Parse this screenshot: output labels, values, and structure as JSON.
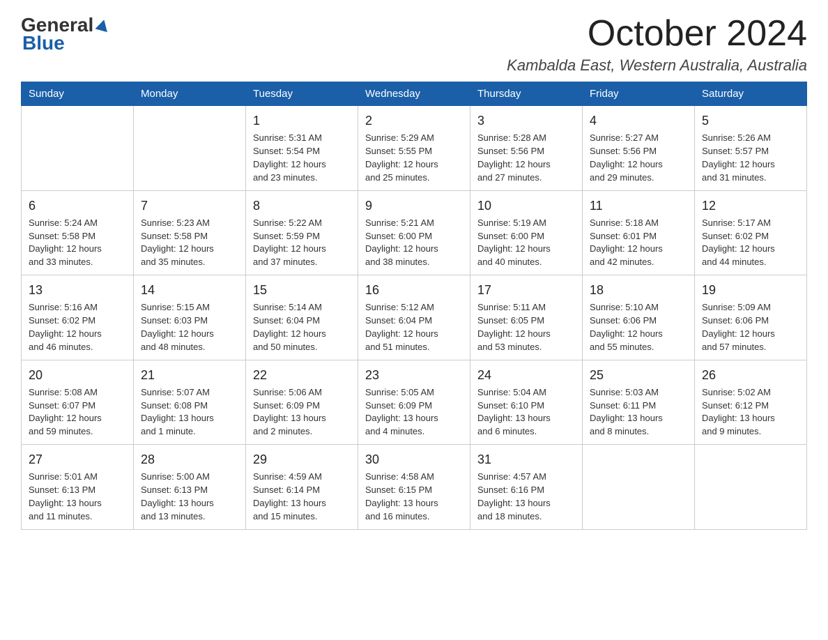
{
  "header": {
    "logo_text1": "General",
    "logo_text2": "Blue",
    "month_title": "October 2024",
    "location": "Kambalda East, Western Australia, Australia"
  },
  "days_of_week": [
    "Sunday",
    "Monday",
    "Tuesday",
    "Wednesday",
    "Thursday",
    "Friday",
    "Saturday"
  ],
  "weeks": [
    [
      {
        "day": "",
        "info": ""
      },
      {
        "day": "",
        "info": ""
      },
      {
        "day": "1",
        "info": "Sunrise: 5:31 AM\nSunset: 5:54 PM\nDaylight: 12 hours\nand 23 minutes."
      },
      {
        "day": "2",
        "info": "Sunrise: 5:29 AM\nSunset: 5:55 PM\nDaylight: 12 hours\nand 25 minutes."
      },
      {
        "day": "3",
        "info": "Sunrise: 5:28 AM\nSunset: 5:56 PM\nDaylight: 12 hours\nand 27 minutes."
      },
      {
        "day": "4",
        "info": "Sunrise: 5:27 AM\nSunset: 5:56 PM\nDaylight: 12 hours\nand 29 minutes."
      },
      {
        "day": "5",
        "info": "Sunrise: 5:26 AM\nSunset: 5:57 PM\nDaylight: 12 hours\nand 31 minutes."
      }
    ],
    [
      {
        "day": "6",
        "info": "Sunrise: 5:24 AM\nSunset: 5:58 PM\nDaylight: 12 hours\nand 33 minutes."
      },
      {
        "day": "7",
        "info": "Sunrise: 5:23 AM\nSunset: 5:58 PM\nDaylight: 12 hours\nand 35 minutes."
      },
      {
        "day": "8",
        "info": "Sunrise: 5:22 AM\nSunset: 5:59 PM\nDaylight: 12 hours\nand 37 minutes."
      },
      {
        "day": "9",
        "info": "Sunrise: 5:21 AM\nSunset: 6:00 PM\nDaylight: 12 hours\nand 38 minutes."
      },
      {
        "day": "10",
        "info": "Sunrise: 5:19 AM\nSunset: 6:00 PM\nDaylight: 12 hours\nand 40 minutes."
      },
      {
        "day": "11",
        "info": "Sunrise: 5:18 AM\nSunset: 6:01 PM\nDaylight: 12 hours\nand 42 minutes."
      },
      {
        "day": "12",
        "info": "Sunrise: 5:17 AM\nSunset: 6:02 PM\nDaylight: 12 hours\nand 44 minutes."
      }
    ],
    [
      {
        "day": "13",
        "info": "Sunrise: 5:16 AM\nSunset: 6:02 PM\nDaylight: 12 hours\nand 46 minutes."
      },
      {
        "day": "14",
        "info": "Sunrise: 5:15 AM\nSunset: 6:03 PM\nDaylight: 12 hours\nand 48 minutes."
      },
      {
        "day": "15",
        "info": "Sunrise: 5:14 AM\nSunset: 6:04 PM\nDaylight: 12 hours\nand 50 minutes."
      },
      {
        "day": "16",
        "info": "Sunrise: 5:12 AM\nSunset: 6:04 PM\nDaylight: 12 hours\nand 51 minutes."
      },
      {
        "day": "17",
        "info": "Sunrise: 5:11 AM\nSunset: 6:05 PM\nDaylight: 12 hours\nand 53 minutes."
      },
      {
        "day": "18",
        "info": "Sunrise: 5:10 AM\nSunset: 6:06 PM\nDaylight: 12 hours\nand 55 minutes."
      },
      {
        "day": "19",
        "info": "Sunrise: 5:09 AM\nSunset: 6:06 PM\nDaylight: 12 hours\nand 57 minutes."
      }
    ],
    [
      {
        "day": "20",
        "info": "Sunrise: 5:08 AM\nSunset: 6:07 PM\nDaylight: 12 hours\nand 59 minutes."
      },
      {
        "day": "21",
        "info": "Sunrise: 5:07 AM\nSunset: 6:08 PM\nDaylight: 13 hours\nand 1 minute."
      },
      {
        "day": "22",
        "info": "Sunrise: 5:06 AM\nSunset: 6:09 PM\nDaylight: 13 hours\nand 2 minutes."
      },
      {
        "day": "23",
        "info": "Sunrise: 5:05 AM\nSunset: 6:09 PM\nDaylight: 13 hours\nand 4 minutes."
      },
      {
        "day": "24",
        "info": "Sunrise: 5:04 AM\nSunset: 6:10 PM\nDaylight: 13 hours\nand 6 minutes."
      },
      {
        "day": "25",
        "info": "Sunrise: 5:03 AM\nSunset: 6:11 PM\nDaylight: 13 hours\nand 8 minutes."
      },
      {
        "day": "26",
        "info": "Sunrise: 5:02 AM\nSunset: 6:12 PM\nDaylight: 13 hours\nand 9 minutes."
      }
    ],
    [
      {
        "day": "27",
        "info": "Sunrise: 5:01 AM\nSunset: 6:13 PM\nDaylight: 13 hours\nand 11 minutes."
      },
      {
        "day": "28",
        "info": "Sunrise: 5:00 AM\nSunset: 6:13 PM\nDaylight: 13 hours\nand 13 minutes."
      },
      {
        "day": "29",
        "info": "Sunrise: 4:59 AM\nSunset: 6:14 PM\nDaylight: 13 hours\nand 15 minutes."
      },
      {
        "day": "30",
        "info": "Sunrise: 4:58 AM\nSunset: 6:15 PM\nDaylight: 13 hours\nand 16 minutes."
      },
      {
        "day": "31",
        "info": "Sunrise: 4:57 AM\nSunset: 6:16 PM\nDaylight: 13 hours\nand 18 minutes."
      },
      {
        "day": "",
        "info": ""
      },
      {
        "day": "",
        "info": ""
      }
    ]
  ]
}
